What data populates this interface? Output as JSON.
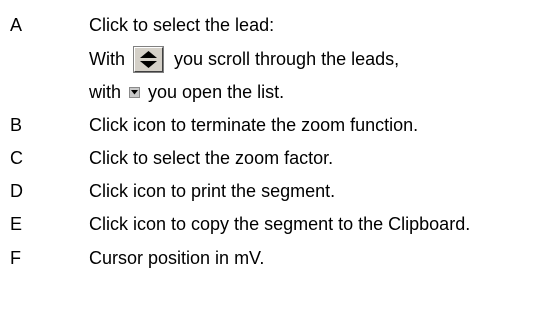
{
  "legend": {
    "a": {
      "letter": "A",
      "line1": "Click to select the lead:",
      "line2_prefix": "With",
      "line2_suffix": "you scroll through the leads,",
      "line3_prefix": "with",
      "line3_suffix": "you open the list."
    },
    "b": {
      "letter": "B",
      "text": "Click icon to terminate the zoom function."
    },
    "c": {
      "letter": "C",
      "text": "Click to select the zoom factor."
    },
    "d": {
      "letter": "D",
      "text": "Click icon to print the segment."
    },
    "e": {
      "letter": "E",
      "text": "Click icon to copy the segment to the Clipboard."
    },
    "f": {
      "letter": "F",
      "text": "Cursor position in mV."
    }
  },
  "icons": {
    "spin": "scroll-up-down-icon",
    "dropdown": "dropdown-arrow-icon"
  }
}
